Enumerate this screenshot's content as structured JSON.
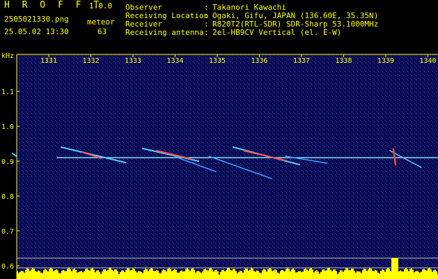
{
  "header": {
    "app_title": "H R O F F T",
    "app_version": "1.0.0",
    "file_name": "2505021330.png",
    "date_time": "25.05.02 13:30",
    "meteor_label": "meteor",
    "meteor_count": "63",
    "info": [
      {
        "label": "Observer",
        "sep": ":",
        "value": "Takanori Kawachi"
      },
      {
        "label": "Receiving Location",
        "sep": ":",
        "value": "Ogaki, Gifu, JAPAN (136.60E, 35.35N)"
      },
      {
        "label": "Receiver",
        "sep": ":",
        "value": "R820T2(RTL-SDR) SDR-Sharp 53.1000MHz"
      },
      {
        "label": "Receiving antenna",
        "sep": ":",
        "value": "2el-HB9CV Vertical (el. E-W)"
      }
    ]
  },
  "axes": {
    "y_unit": "kHz",
    "x_ticks": [
      "1331",
      "1332",
      "1333",
      "1334",
      "1335",
      "1336",
      "1337",
      "1338",
      "1339",
      "1340"
    ],
    "y_ticks": [
      "1.1",
      "1.0",
      "0.9",
      "0.8",
      "0.7",
      "0.6"
    ]
  },
  "colors": {
    "header_text_yellow": "#ffff00",
    "header_text_green": "#00ff00",
    "waterfall_background": "#0a0a50",
    "carrier_line": "#7fe6ff",
    "level_bars": "#ffff00"
  }
}
